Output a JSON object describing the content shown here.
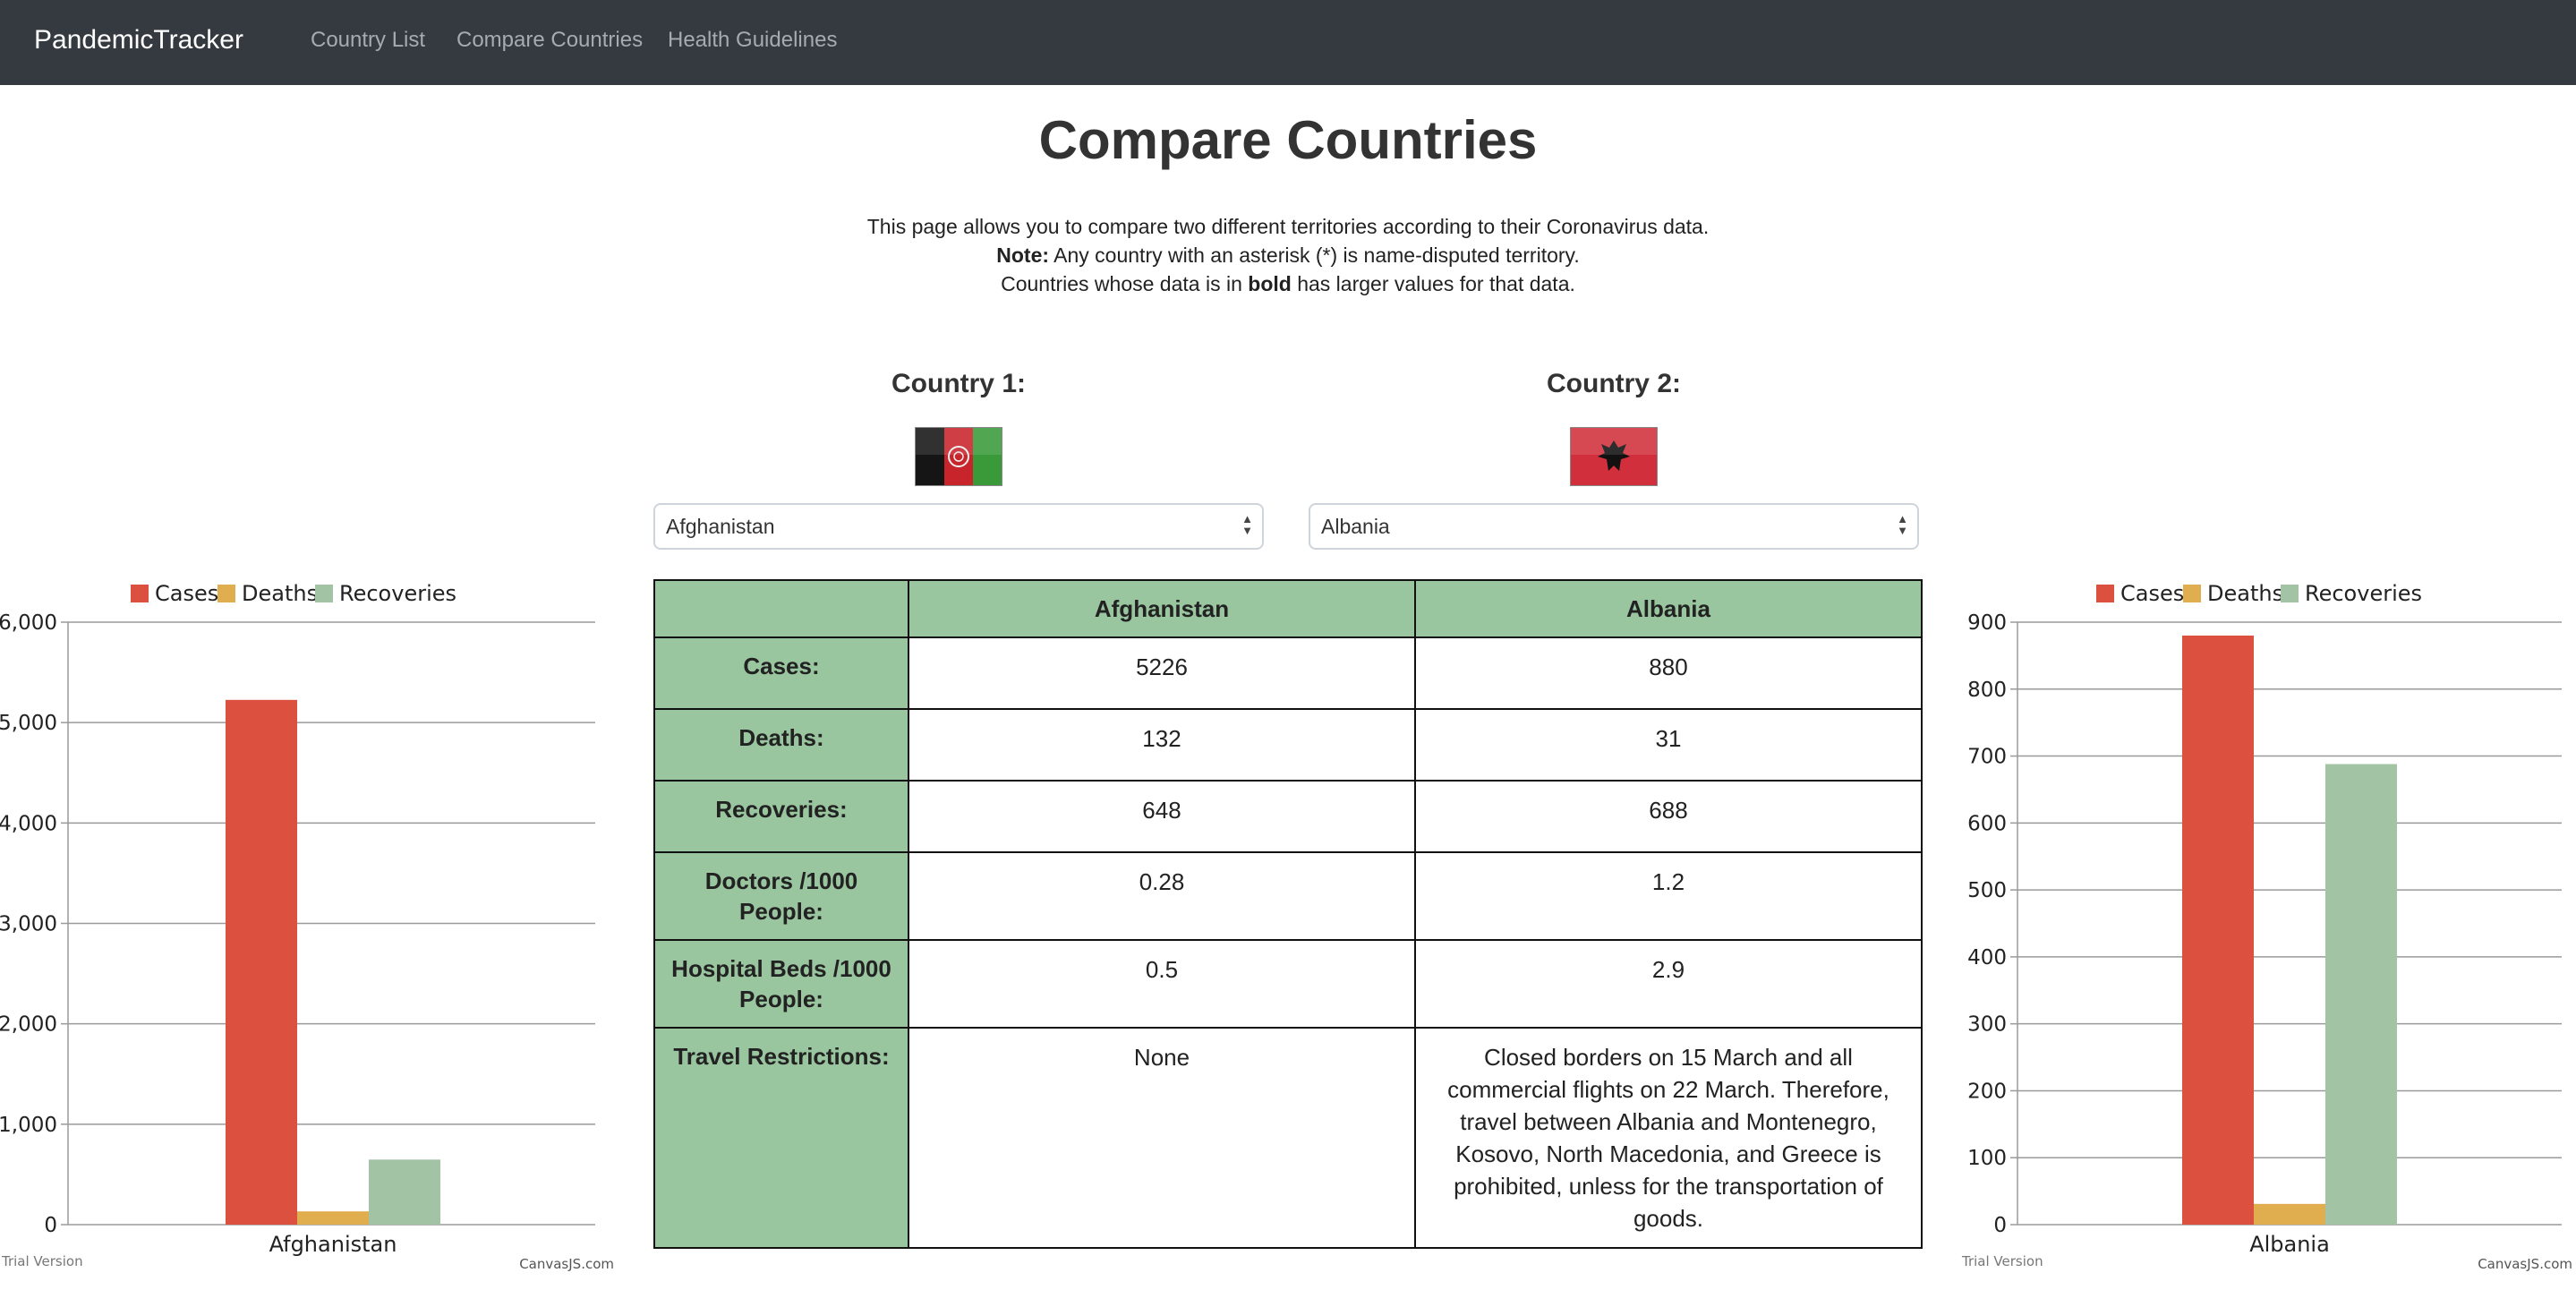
{
  "navbar": {
    "brand": "PandemicTracker",
    "links": [
      "Country List",
      "Compare Countries",
      "Health Guidelines"
    ]
  },
  "page": {
    "title": "Compare Countries",
    "intro_line1": "This page allows you to compare two different territories according to their Coronavirus data.",
    "note_label": "Note:",
    "note_text": " Any country with an asterisk (*) is name-disputed territory.",
    "bold_pre": "Countries whose data is in ",
    "bold_word": "bold",
    "bold_post": " has larger values for that data."
  },
  "country1": {
    "label": "Country 1:",
    "selected": "Afghanistan",
    "flag": "afghanistan-flag"
  },
  "country2": {
    "label": "Country 2:",
    "selected": "Albania",
    "flag": "albania-flag"
  },
  "table": {
    "headers": [
      "",
      "Afghanistan",
      "Albania"
    ],
    "rows": [
      {
        "label": "Cases:",
        "c1": "5226",
        "c2": "880"
      },
      {
        "label": "Deaths:",
        "c1": "132",
        "c2": "31"
      },
      {
        "label": "Recoveries:",
        "c1": "648",
        "c2": "688"
      },
      {
        "label": "Doctors /1000 People:",
        "c1": "0.28",
        "c2": "1.2"
      },
      {
        "label": "Hospital Beds /1000 People:",
        "c1": "0.5",
        "c2": "2.9"
      },
      {
        "label": "Travel Restrictions:",
        "c1": "None",
        "c2": "Closed borders on 15 March and all commercial flights on 22 March. Therefore, travel between Albania and Montenegro, Kosovo, North Macedonia, and Greece is prohibited, unless for the transportation of goods."
      }
    ]
  },
  "colors": {
    "cases": "#dc5040",
    "deaths": "#e0ad4f",
    "recoveries": "#a3c3a5",
    "header_bg": "#99c59f",
    "navbar": "#343a40"
  },
  "chart_data": [
    {
      "type": "bar",
      "categories": [
        "Afghanistan"
      ],
      "series": [
        {
          "name": "Cases",
          "values": [
            5226
          ]
        },
        {
          "name": "Deaths",
          "values": [
            132
          ]
        },
        {
          "name": "Recoveries",
          "values": [
            648
          ]
        }
      ],
      "ylim": [
        0,
        6000
      ],
      "yticks": [
        "0",
        "1,000",
        "2,000",
        "3,000",
        "4,000",
        "5,000",
        "6,000"
      ],
      "grid": true,
      "legend": "top-center",
      "footer_left": "Trial Version",
      "footer_right": "CanvasJS.com"
    },
    {
      "type": "bar",
      "categories": [
        "Albania"
      ],
      "series": [
        {
          "name": "Cases",
          "values": [
            880
          ]
        },
        {
          "name": "Deaths",
          "values": [
            31
          ]
        },
        {
          "name": "Recoveries",
          "values": [
            688
          ]
        }
      ],
      "ylim": [
        0,
        900
      ],
      "yticks": [
        "0",
        "100",
        "200",
        "300",
        "400",
        "500",
        "600",
        "700",
        "800",
        "900"
      ],
      "grid": true,
      "legend": "top-center",
      "footer_left": "Trial Version",
      "footer_right": "CanvasJS.com"
    }
  ]
}
